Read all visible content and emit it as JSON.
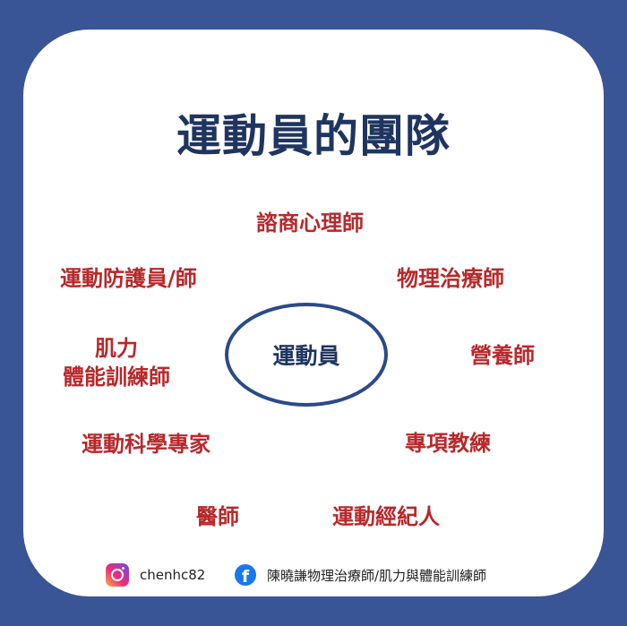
{
  "title": "運動員的團隊",
  "center": "運動員",
  "roles": {
    "counselor": "諮商心理師",
    "physical_therapist": "物理治療師",
    "nutritionist": "營養師",
    "coach": "專項教練",
    "agent": "運動經紀人",
    "doctor": "醫師",
    "sport_scientist": "運動科學專家",
    "strength_line1": "肌力",
    "strength_line2": "體能訓練師",
    "athletic_trainer": "運動防護員/師"
  },
  "footer": {
    "instagram_handle": "chenhc82",
    "facebook_page": "陳曉謙物理治療師/肌力與體能訓練師"
  },
  "colors": {
    "background": "#3a5595",
    "card": "#ffffff",
    "title": "#1f3560",
    "role_text": "#b8282a",
    "ellipse": "#2a4a8a"
  }
}
